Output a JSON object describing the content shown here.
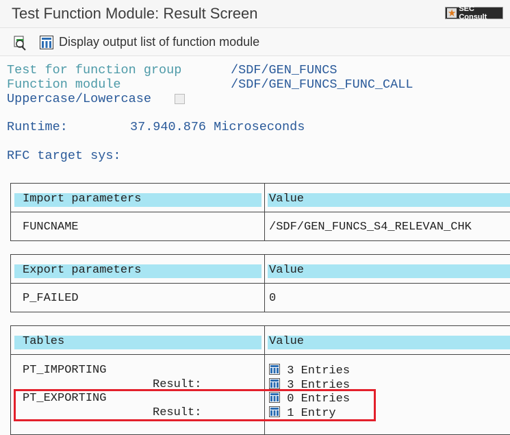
{
  "window": {
    "title": "Test Function Module: Result Screen",
    "logo_text": "SEC Consult"
  },
  "toolbar": {
    "display_output_label": "Display output list of function module"
  },
  "info": {
    "function_group_label": "Test for function group",
    "function_group_value": "/SDF/GEN_FUNCS",
    "function_module_label": "Function module",
    "function_module_value": "/SDF/GEN_FUNCS_FUNC_CALL",
    "case_label": "Uppercase/Lowercase",
    "case_checked": false,
    "runtime_label": "Runtime:",
    "runtime_value": "37.940.876 Microseconds",
    "rfc_label": "RFC target sys:"
  },
  "import": {
    "header": "Import parameters",
    "value_header": "Value",
    "rows": [
      {
        "name": "FUNCNAME",
        "value": "/SDF/GEN_FUNCS_S4_RELEVAN_CHK"
      }
    ]
  },
  "export": {
    "header": "Export parameters",
    "value_header": "Value",
    "rows": [
      {
        "name": "P_FAILED",
        "value": "0"
      }
    ]
  },
  "tables": {
    "header": "Tables",
    "value_header": "Value",
    "result_label": "Result:",
    "rows": [
      {
        "name": "PT_IMPORTING",
        "value": "3 Entries",
        "result": "3 Entries"
      },
      {
        "name": "PT_EXPORTING",
        "value": "0 Entries",
        "result": "1 Entry"
      }
    ]
  },
  "colors": {
    "header_bg": "#a8e5f3",
    "label": "#4d9aa8",
    "value": "#2a5a9a",
    "highlight": "#e3202b"
  }
}
